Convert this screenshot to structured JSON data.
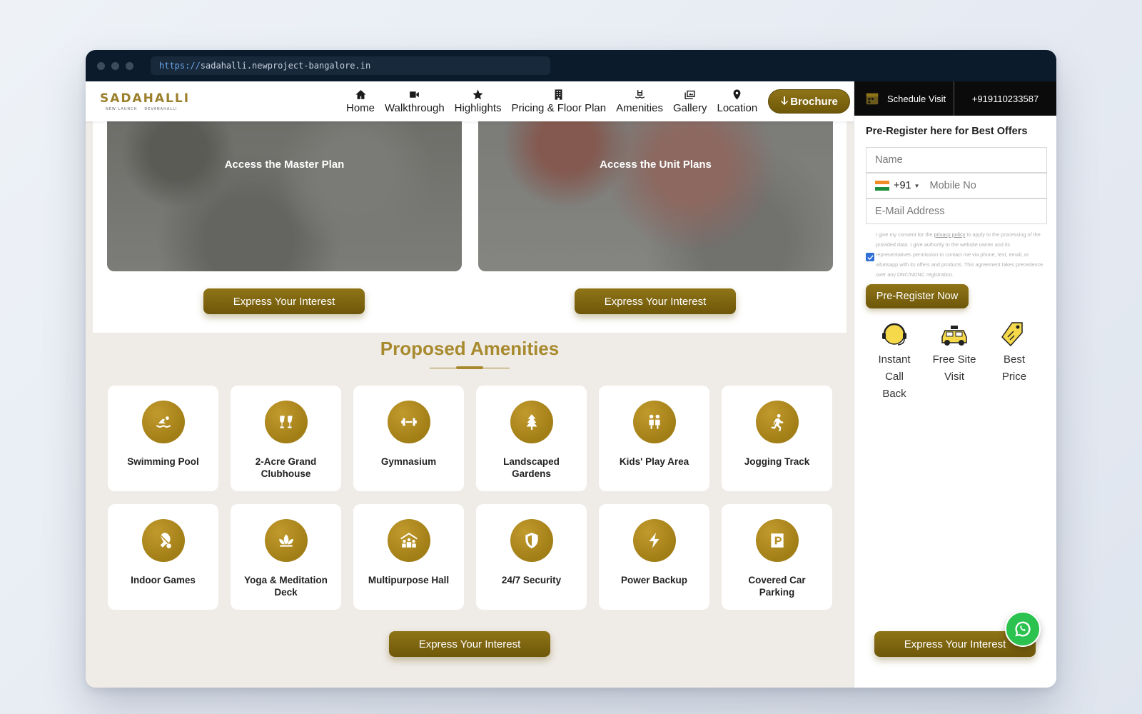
{
  "browser": {
    "url_scheme": "https://",
    "url_rest": "sadahalli.newproject-bangalore.in"
  },
  "logo": {
    "title": "SADAHALLI",
    "sub_left": "NEW LAUNCH",
    "sub_right": "DEVANAHALLI"
  },
  "nav": {
    "items": [
      {
        "label": "Home",
        "icon": "home-icon"
      },
      {
        "label": "Walkthrough",
        "icon": "video-icon"
      },
      {
        "label": "Highlights",
        "icon": "star-icon"
      },
      {
        "label": "Pricing & Floor Plan",
        "icon": "building-icon"
      },
      {
        "label": "Amenities",
        "icon": "pool-icon"
      },
      {
        "label": "Gallery",
        "icon": "images-icon"
      },
      {
        "label": "Location",
        "icon": "map-pin-icon"
      }
    ],
    "brochure": "Brochure"
  },
  "plans": {
    "master_title": "Access the Master Plan",
    "unit_title": "Access the Unit Plans",
    "cta": "Express Your Interest"
  },
  "amenities": {
    "title": "Proposed Amenities",
    "items": [
      {
        "label": "Swimming Pool",
        "icon": "swimmer-icon"
      },
      {
        "label": "2-Acre Grand Clubhouse",
        "icon": "cheers-icon"
      },
      {
        "label": "Gymnasium",
        "icon": "dumbbell-icon"
      },
      {
        "label": "Landscaped Gardens",
        "icon": "tree-icon"
      },
      {
        "label": "Kids' Play Area",
        "icon": "children-icon"
      },
      {
        "label": "Jogging Track",
        "icon": "runner-icon"
      },
      {
        "label": "Indoor Games",
        "icon": "table-tennis-icon"
      },
      {
        "label": "Yoga & Meditation Deck",
        "icon": "lotus-icon"
      },
      {
        "label": "Multipurpose Hall",
        "icon": "people-roof-icon"
      },
      {
        "label": "24/7 Security",
        "icon": "shield-icon"
      },
      {
        "label": "Power Backup",
        "icon": "bolt-icon"
      },
      {
        "label": "Covered Car Parking",
        "icon": "parking-icon"
      }
    ],
    "cta": "Express Your Interest"
  },
  "side": {
    "schedule": "Schedule Visit",
    "phone": "+919110233587",
    "form_title": "Pre-Register here for Best Offers",
    "name_placeholder": "Name",
    "country_code": "+91",
    "mobile_placeholder": "Mobile No",
    "email_placeholder": "E-Mail Address",
    "consent_before": "I give my consent for the ",
    "consent_link": "privacy policy",
    "consent_after": " to apply to the processing of the provided data. I give authority to the website owner and its representatives permission to contact me via phone, text, email, or whatsapp with its offers and products. This agreement takes precedence over any DNC/NDNC registration.",
    "submit": "Pre-Register Now",
    "benefits": [
      {
        "line1": "Instant",
        "line2": "Call",
        "line3": "Back",
        "icon": "headset-icon"
      },
      {
        "line1": "Free Site",
        "line2": "Visit",
        "line3": "",
        "icon": "taxi-icon"
      },
      {
        "line1": "Best",
        "line2": "Price",
        "line3": "",
        "icon": "price-tag-icon"
      }
    ],
    "cta": "Express Your Interest"
  },
  "colors": {
    "gold": "#8f7417",
    "gold_title": "#a88a2e",
    "titlebar": "#0c1b2c",
    "whatsapp": "#2cc24f"
  }
}
